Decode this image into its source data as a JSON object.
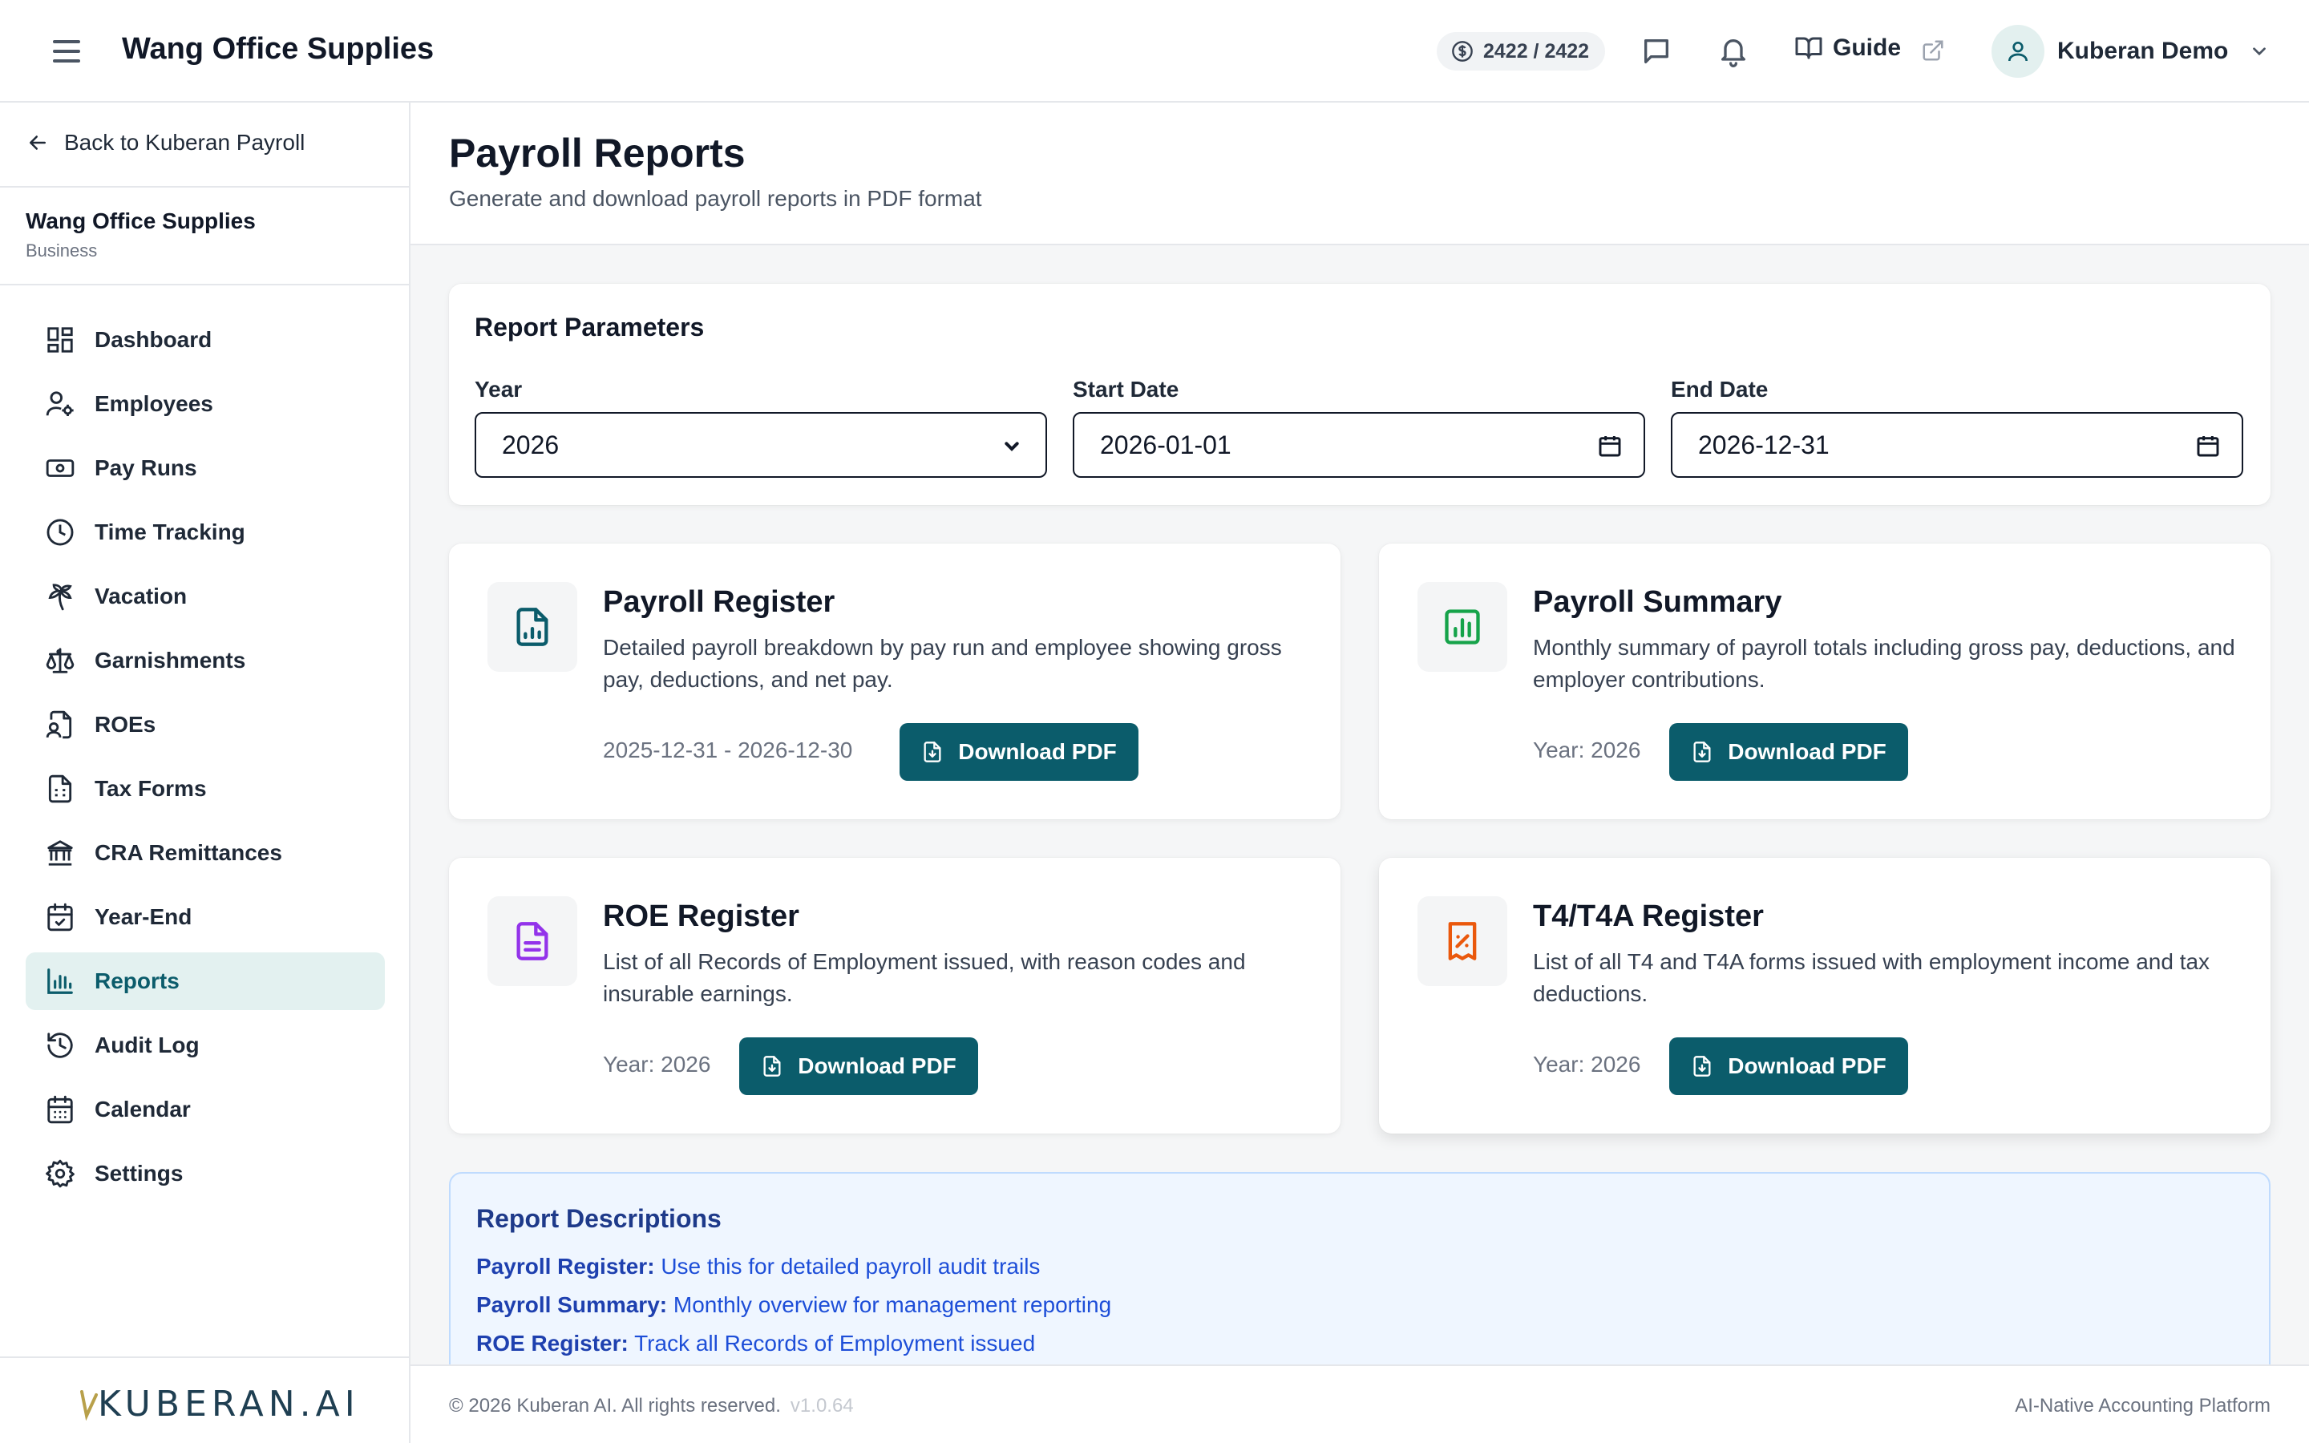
{
  "topbar": {
    "app_title": "Wang Office Supplies",
    "credits": "2422 / 2422",
    "guide_label": "Guide",
    "user_name": "Kuberan Demo"
  },
  "sidebar": {
    "back_label": "Back to Kuberan Payroll",
    "org_name": "Wang Office Supplies",
    "org_type": "Business",
    "items": [
      {
        "label": "Dashboard",
        "icon": "dashboard-icon"
      },
      {
        "label": "Employees",
        "icon": "employees-icon"
      },
      {
        "label": "Pay Runs",
        "icon": "banknote-icon"
      },
      {
        "label": "Time Tracking",
        "icon": "clock-icon"
      },
      {
        "label": "Vacation",
        "icon": "palm-tree-icon"
      },
      {
        "label": "Garnishments",
        "icon": "scale-icon"
      },
      {
        "label": "ROEs",
        "icon": "file-user-icon"
      },
      {
        "label": "Tax Forms",
        "icon": "file-spreadsheet-icon"
      },
      {
        "label": "CRA Remittances",
        "icon": "bank-icon"
      },
      {
        "label": "Year-End",
        "icon": "calendar-check-icon"
      },
      {
        "label": "Reports",
        "icon": "bar-chart-icon",
        "active": true
      },
      {
        "label": "Audit Log",
        "icon": "history-icon"
      },
      {
        "label": "Calendar",
        "icon": "calendar-icon"
      },
      {
        "label": "Settings",
        "icon": "gear-icon"
      }
    ],
    "logo_text": "KUBERAN.AI"
  },
  "header": {
    "title": "Payroll Reports",
    "subtitle": "Generate and download payroll reports in PDF format"
  },
  "params": {
    "title": "Report Parameters",
    "year_label": "Year",
    "year_value": "2026",
    "start_label": "Start Date",
    "start_value": "2026-01-01",
    "end_label": "End Date",
    "end_value": "2026-12-31"
  },
  "reports": [
    {
      "title": "Payroll Register",
      "description": "Detailed payroll breakdown by pay run and employee showing gross pay, deductions, and net pay.",
      "meta": "2025-12-31 - 2026-12-30",
      "button": "Download PDF",
      "icon": "file-chart-icon",
      "color": "#0b5c6b"
    },
    {
      "title": "Payroll Summary",
      "description": "Monthly summary of payroll totals including gross pay, deductions, and employer contributions.",
      "meta": "Year: 2026",
      "button": "Download PDF",
      "icon": "bar-chart-square-icon",
      "color": "#16a34a"
    },
    {
      "title": "ROE Register",
      "description": "List of all Records of Employment issued, with reason codes and insurable earnings.",
      "meta": "Year: 2026",
      "button": "Download PDF",
      "icon": "file-text-icon",
      "color": "#9333ea"
    },
    {
      "title": "T4/T4A Register",
      "description": "List of all T4 and T4A forms issued with employment income and tax deductions.",
      "meta": "Year: 2026",
      "button": "Download PDF",
      "icon": "receipt-percent-icon",
      "color": "#ea580c"
    }
  ],
  "descriptions": {
    "title": "Report Descriptions",
    "lines": [
      {
        "term": "Payroll Register:",
        "text": "Use this for detailed payroll audit trails"
      },
      {
        "term": "Payroll Summary:",
        "text": "Monthly overview for management reporting"
      },
      {
        "term": "ROE Register:",
        "text": "Track all Records of Employment issued"
      }
    ]
  },
  "footer": {
    "copyright": "© 2026 Kuberan AI. All rights reserved.",
    "version": "v1.0.64",
    "tagline": "AI-Native Accounting Platform"
  }
}
